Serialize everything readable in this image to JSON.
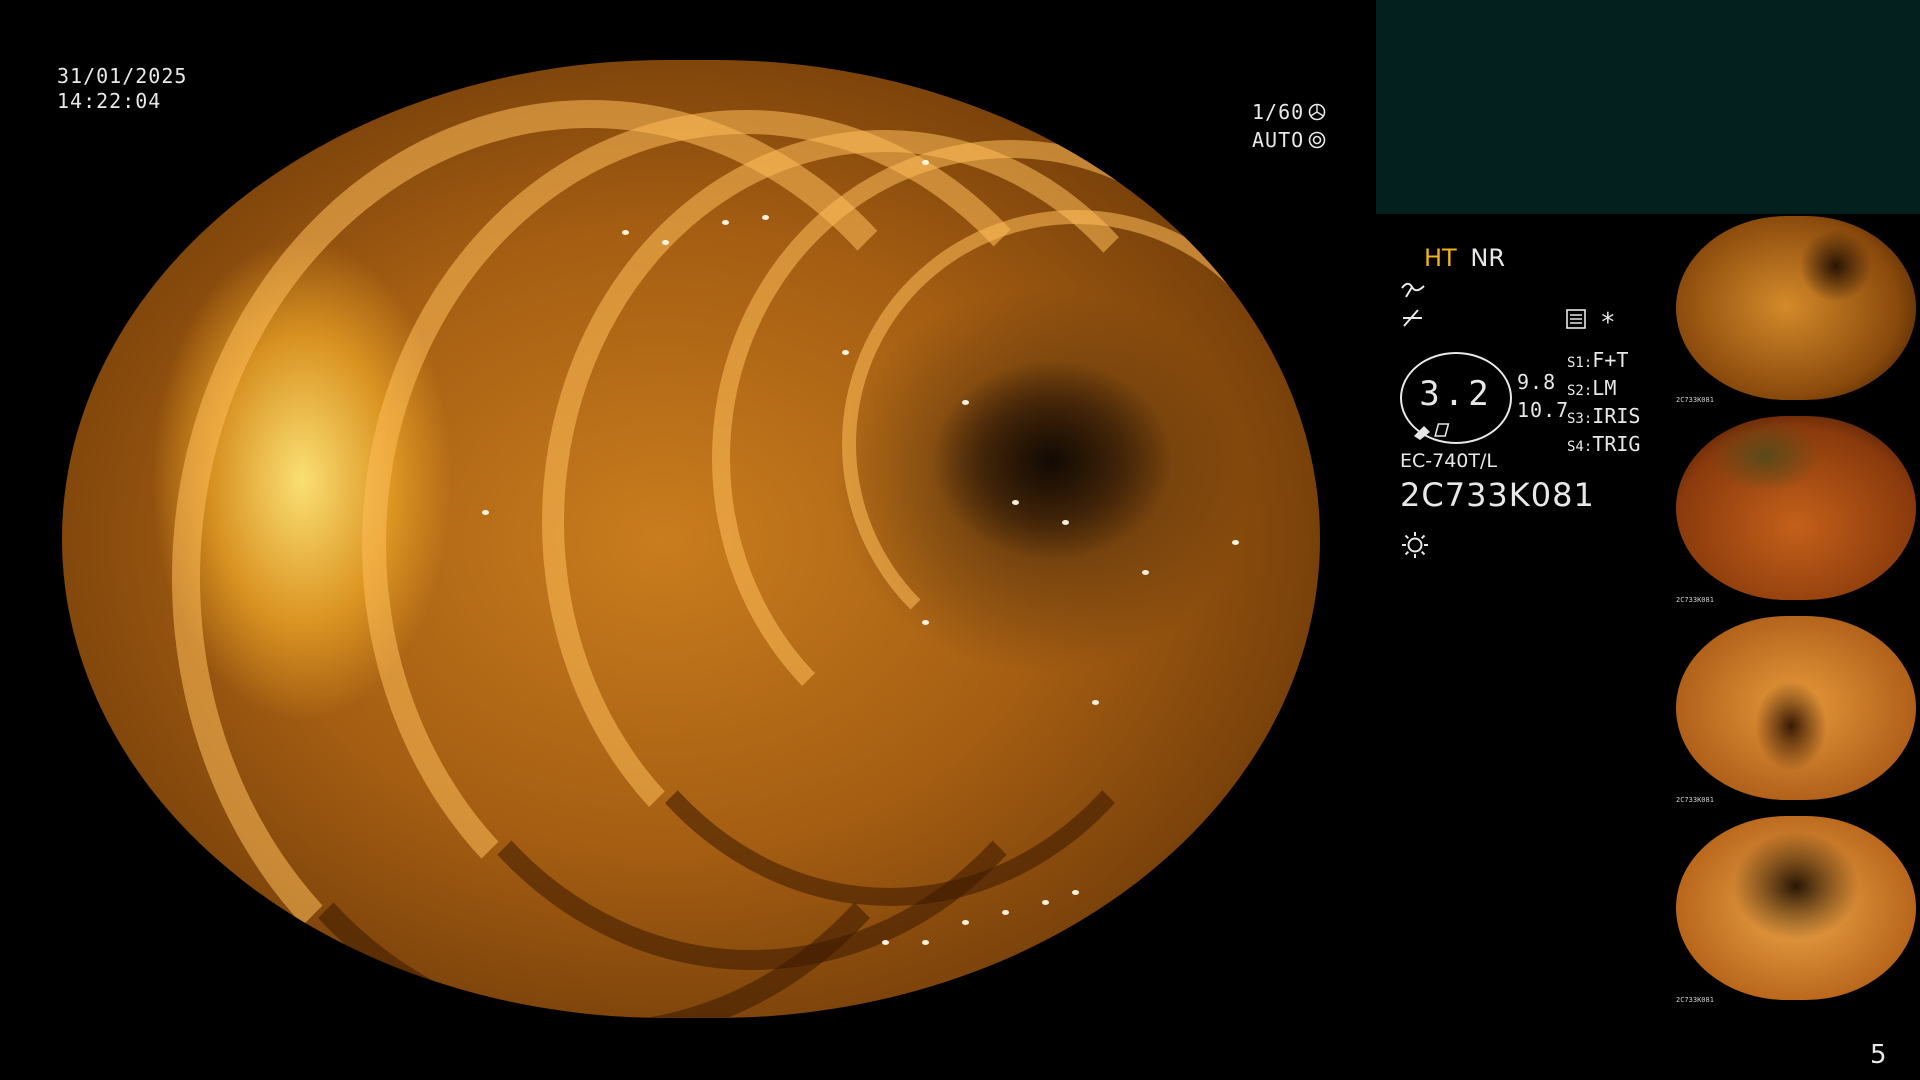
{
  "overlay": {
    "date": "31/01/2025",
    "time": "14:22:04",
    "shutter": "1/60",
    "mode": "AUTO",
    "enhance_ht": "HT",
    "enhance_nr": "NR",
    "gauge_value": "3.2",
    "side_value_1": "9.8",
    "side_value_2": "10.7",
    "switches": [
      {
        "key": "S1:",
        "value": "F+T"
      },
      {
        "key": "S2:",
        "value": "LM"
      },
      {
        "key": "S3:",
        "value": "IRIS"
      },
      {
        "key": "S4:",
        "value": "TRIG"
      }
    ],
    "scope_model": "EC-740T/L",
    "serial": "2C733K081",
    "asterisk": "*",
    "page_number": "5"
  },
  "thumbnails": [
    {
      "caption": "2C733K081"
    },
    {
      "caption": "2C733K081"
    },
    {
      "caption": "2C733K081"
    },
    {
      "caption": "2C733K081"
    }
  ],
  "icons": [
    "shutter-icon",
    "iris-icon",
    "curve-icon",
    "filter-icon",
    "menu-icon",
    "brightness-icon"
  ],
  "colors": {
    "ht_label": "#f5b21a",
    "panel_teal": "#03201f",
    "mucosa": "#c97d1e"
  }
}
